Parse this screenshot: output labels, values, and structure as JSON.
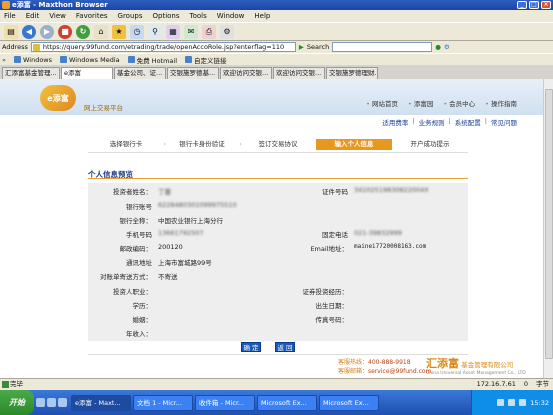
{
  "window": {
    "title": "e添富 - Maxthon Browser"
  },
  "menu": [
    "File",
    "Edit",
    "View",
    "Favorites",
    "Groups",
    "Options",
    "Tools",
    "Window",
    "Help"
  ],
  "address": {
    "label": "Address",
    "url": "https://query.99fund.com/etrading/trade/openAccoRole.jsp?enterflag=110",
    "search_label": "Search"
  },
  "favorites": [
    "Windows",
    "Windows Media",
    "免费 Hotmail",
    "自定义链接"
  ],
  "tabs": [
    "汇添富基金管理...",
    "e添富",
    "基金公司、证...",
    "交银施罗德基...",
    "欢迎访问交银...",
    "欢迎访问交银...",
    "交银施罗德理财..."
  ],
  "site": {
    "logo_text": "e添富",
    "logo_sub": "网上交易平台",
    "topnav": [
      "网站首页",
      "添富园",
      "会员中心",
      "操作指南"
    ],
    "subnav": [
      "适用费率",
      "业务规则",
      "系统配置",
      "常见问题"
    ],
    "steps": [
      "选择银行卡",
      "银行卡身份验证",
      "签订交易协议",
      "输入个人信息",
      "开户成功提示"
    ],
    "section_title": "个人信息预览",
    "fields": {
      "name_label": "投资者姓名：",
      "name_value": "丁蕾",
      "id_label": "证件号码",
      "id_value": "34102519830822004X",
      "account_label": "银行账号",
      "account_value": "6228480301099975510",
      "bank_label": "银行全称：",
      "bank_value": "中国农业银行上海分行",
      "mobile_label": "手机号码",
      "mobile_value": "13661792507",
      "phone_label": "固定电话",
      "phone_value": "021-39832999",
      "zip_label": "邮政编码：",
      "zip_value": "200120",
      "email_label": "Email地址：",
      "email_value": "mainei7720008163.com",
      "addr_label": "通讯地址",
      "addr_value": "上海市富城路99号",
      "mail_label": "对账单寄送方式：",
      "mail_value": "不寄送",
      "job_label": "投资人职业：",
      "exp_label": "证券投资经历：",
      "edu_label": "学历：",
      "birth_label": "出生日期：",
      "marriage_label": "婚姻：",
      "fax_label": "传真号码：",
      "income_label": "年收入："
    },
    "buttons": {
      "confirm": "确 定",
      "back": "返 回"
    },
    "contact": {
      "hotline_label": "客服热线：",
      "hotline": "400-888-9918",
      "email_label": "客服邮箱：",
      "email": "service@99fund.com"
    },
    "brand": {
      "name": "汇添富",
      "sub": "基金管理有限公司",
      "en": "China Universal Asset Management Co., LTD"
    }
  },
  "status": {
    "text": "完毕",
    "ip": "172.16.7.61",
    "zero": "0",
    "bytes": "字节"
  },
  "taskbar": {
    "start": "开始",
    "items": [
      "e添富 - Maxt...",
      "文档 1 - Micr...",
      "收件箱 - Micr...",
      "Microsoft Ex...",
      "Microsoft Ex..."
    ],
    "clock": "15:32"
  },
  "colors": {
    "accent_orange": "#e89820",
    "link_blue": "#1a3a9a",
    "button_blue": "#1a5ab8"
  }
}
